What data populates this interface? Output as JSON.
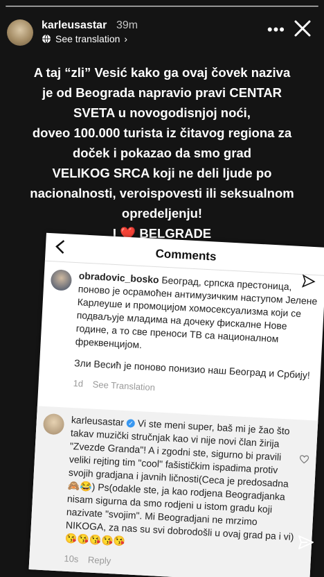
{
  "header": {
    "username": "karleusastar",
    "time": "39m",
    "translation": "See translation",
    "chevron": "›"
  },
  "caption": {
    "lines": [
      "A taj “zli” Vesić kako ga ovaj čovek naziva",
      "je od Beograda napravio pravi CENTAR",
      "SVETA u novogodisnjoj noći,",
      "doveo 100.000 turista iz čitavog regiona za",
      "doček i pokazao da smo grad",
      "VELIKOG SRCA koji ne deli ljude po",
      "nacionalnosti, veroispovesti ili seksualnom",
      "opredeljenju!"
    ],
    "final_prefix": "I",
    "heart": "❤️",
    "final_suffix": "BELGRADE"
  },
  "screenshot": {
    "title": "Comments",
    "comment1": {
      "username": "obradovic_bosko",
      "text": "Београд, српска престоница, поново је осрамоћен антимузичким наступом Јелене Карлеуше и промоцијом хомосексуализма који се подваљује младима на дочеку фискалне Нове године, а то све преноси ТВ са националном фреквенцијом.",
      "text2": "Зли Весић је поново понизио наш Београд и Србију!",
      "time": "1d",
      "see_translation": "See Translation"
    },
    "comment2": {
      "username": "karleusastar",
      "text": "Vi ste meni super, baš mi je žao što takav muzički stručnjak kao vi nije novi član žirija \"Zvezde Granda\"! A i zgodni ste, sigurno bi pravili veliki rejting tim \"cool\" fašističkim ispadima protiv svojih gradjana i javnih ličnosti(Ceca je predosadna🙈😂) Ps(odakle ste, ja kao rodjena Beogradjanka nisam sigurna da smo rodjeni u istom gradu koji nazivate \"svojim\". Mi Beogradjani ne mrzimo NIKOGA, za nas su svi dobrodošli u ovaj grad pa i vi)",
      "emoji_row": "😘😘😘😘😘",
      "time": "10s",
      "reply": "Reply"
    }
  }
}
